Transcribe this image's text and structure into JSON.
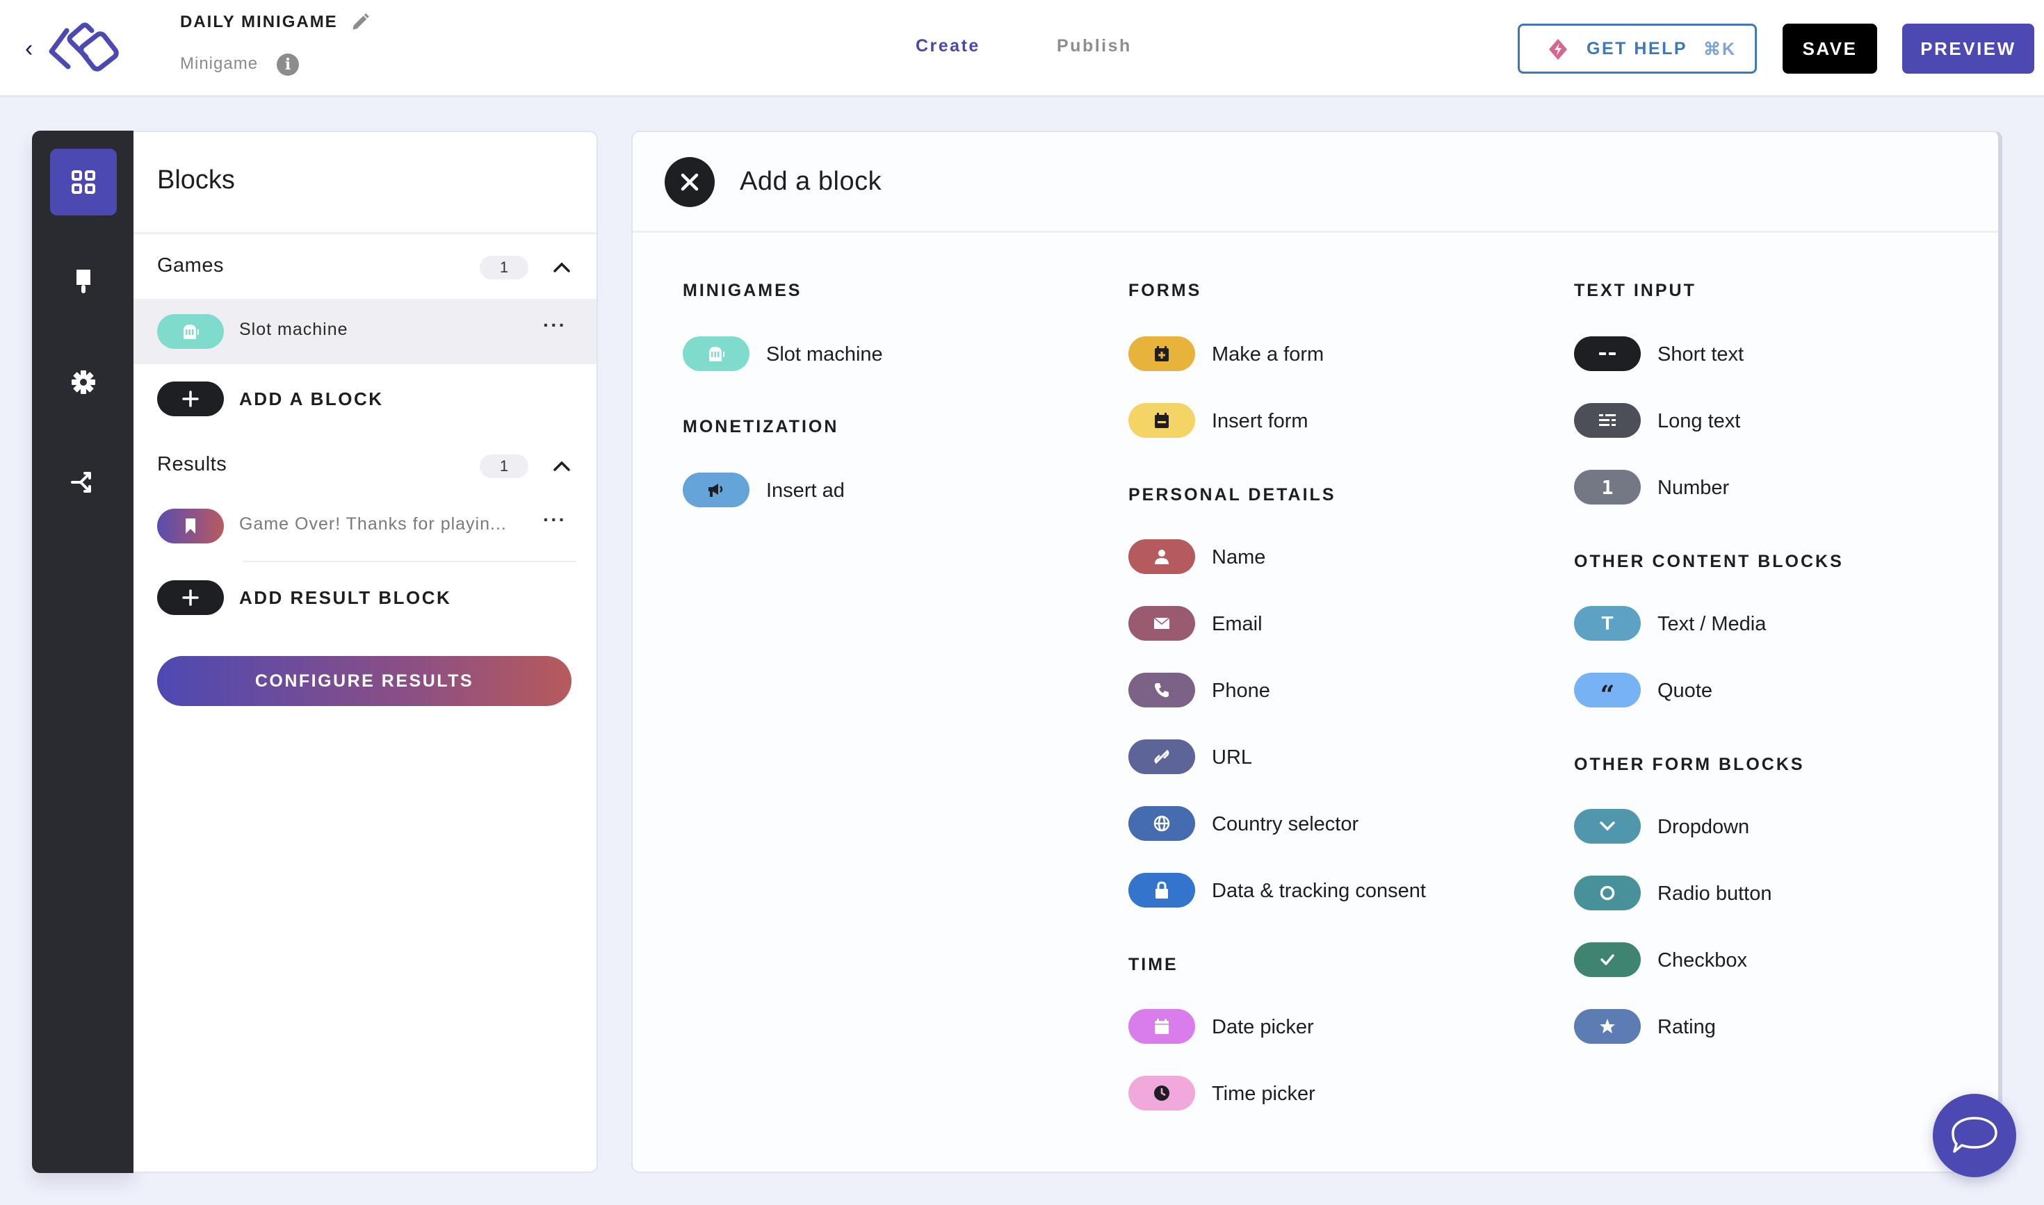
{
  "header": {
    "title": "DAILY MINIGAME",
    "subtitle": "Minigame",
    "info_glyph": "i",
    "tabs": [
      {
        "label": "Create",
        "active": true
      },
      {
        "label": "Publish",
        "active": false
      }
    ],
    "help_label": "GET HELP",
    "help_shortcut": "⌘K",
    "save_label": "SAVE",
    "preview_label": "PREVIEW",
    "accent_color": "#4d49b3"
  },
  "rail": {
    "items": [
      {
        "name": "blocks",
        "icon": "grid-icon",
        "active": true
      },
      {
        "name": "design",
        "icon": "paintbrush-icon",
        "active": false
      },
      {
        "name": "settings",
        "icon": "gear-icon",
        "active": false
      },
      {
        "name": "flow",
        "icon": "branch-icon",
        "active": false
      }
    ]
  },
  "blocks_panel": {
    "title": "Blocks",
    "groups": [
      {
        "name": "Games",
        "count": "1",
        "items": [
          {
            "label": "Slot machine",
            "icon": "slot-machine-icon",
            "color": "#7fdccd"
          }
        ],
        "add_label": "ADD A BLOCK"
      },
      {
        "name": "Results",
        "count": "1",
        "items": [
          {
            "label": "Game Over! Thanks for playin...",
            "icon": "bookmark-icon"
          }
        ],
        "add_label": "ADD RESULT BLOCK"
      }
    ],
    "more_glyph": "···",
    "configure_label": "CONFIGURE RESULTS"
  },
  "add_block": {
    "title": "Add a block",
    "columns": [
      {
        "sections": [
          {
            "title": "MINIGAMES",
            "items": [
              {
                "label": "Slot machine",
                "icon": "slot-machine-icon",
                "color": "#7fdccd"
              }
            ]
          },
          {
            "title": "MONETIZATION",
            "items": [
              {
                "label": "Insert ad",
                "icon": "megaphone-icon",
                "color": "#64a4d8"
              }
            ]
          }
        ]
      },
      {
        "sections": [
          {
            "title": "FORMS",
            "items": [
              {
                "label": "Make a form",
                "icon": "calendar-plus-icon",
                "color": "#e8b33a"
              },
              {
                "label": "Insert form",
                "icon": "calendar-form-icon",
                "color": "#f5d466"
              }
            ]
          },
          {
            "title": "PERSONAL DETAILS",
            "items": [
              {
                "label": "Name",
                "icon": "person-icon",
                "color": "#b55a5d"
              },
              {
                "label": "Email",
                "icon": "envelope-icon",
                "color": "#9a5a70"
              },
              {
                "label": "Phone",
                "icon": "phone-icon",
                "color": "#7c6286"
              },
              {
                "label": "URL",
                "icon": "link-icon",
                "color": "#5d6498"
              },
              {
                "label": "Country selector",
                "icon": "globe-icon",
                "color": "#466cb0"
              },
              {
                "label": "Data & tracking consent",
                "icon": "lock-icon",
                "color": "#3474cc"
              }
            ]
          },
          {
            "title": "TIME",
            "items": [
              {
                "label": "Date picker",
                "icon": "calendar-icon",
                "color": "#d97cec"
              },
              {
                "label": "Time picker",
                "icon": "clock-icon",
                "color": "#f1a8da"
              }
            ]
          }
        ]
      },
      {
        "sections": [
          {
            "title": "TEXT INPUT",
            "items": [
              {
                "label": "Short text",
                "icon": "short-text-icon",
                "color": "#1e1f23"
              },
              {
                "label": "Long text",
                "icon": "long-text-icon",
                "color": "#4c4f57"
              },
              {
                "label": "Number",
                "icon": "number-icon",
                "color": "#747884"
              }
            ]
          },
          {
            "title": "OTHER CONTENT BLOCKS",
            "items": [
              {
                "label": "Text / Media",
                "icon": "text-icon",
                "color": "#5da2c4"
              },
              {
                "label": "Quote",
                "icon": "quote-icon",
                "color": "#77b2f4"
              }
            ]
          },
          {
            "title": "OTHER FORM BLOCKS",
            "items": [
              {
                "label": "Dropdown",
                "icon": "chevron-down-icon",
                "color": "#5097ad"
              },
              {
                "label": "Radio button",
                "icon": "radio-icon",
                "color": "#48909a"
              },
              {
                "label": "Checkbox",
                "icon": "check-icon",
                "color": "#3f8470"
              },
              {
                "label": "Rating",
                "icon": "star-icon",
                "color": "#5b7db4"
              }
            ]
          }
        ]
      }
    ]
  }
}
